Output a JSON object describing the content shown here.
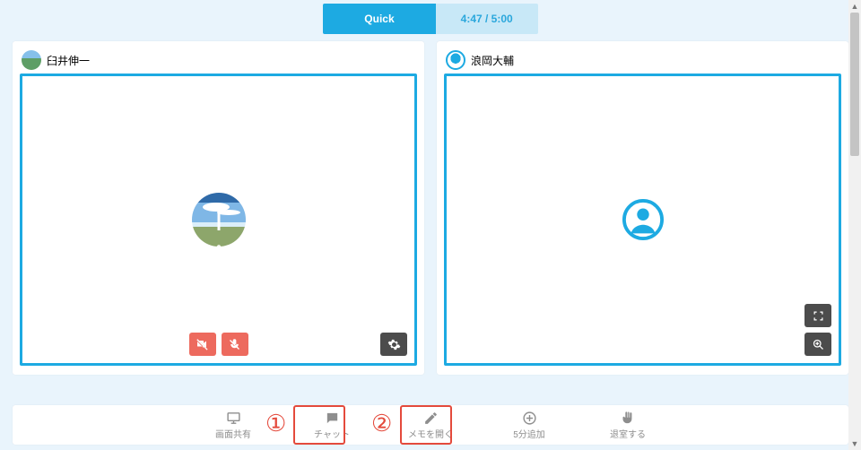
{
  "header": {
    "mode": "Quick",
    "timer": "4:47 / 5:00"
  },
  "panels": [
    {
      "name": "臼井伸一",
      "avatar": "landscape"
    },
    {
      "name": "浪岡大輔",
      "avatar": "person"
    }
  ],
  "toolbar": {
    "share": "画面共有",
    "chat": "チャット",
    "memo": "メモを開く",
    "extend": "5分追加",
    "leave": "退室する"
  },
  "annotations": {
    "one": "①",
    "two": "②"
  }
}
